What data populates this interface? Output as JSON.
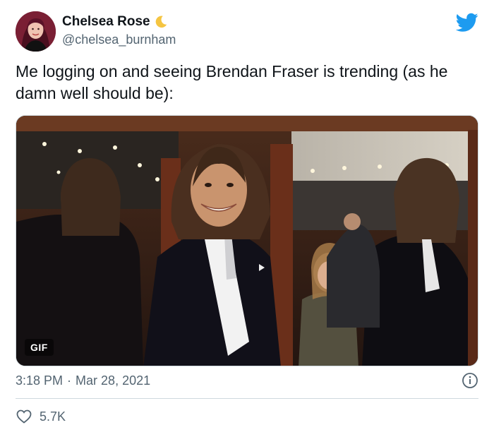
{
  "author": {
    "display_name": "Chelsea Rose",
    "name_emoji": "crescent-moon-icon",
    "handle": "@chelsea_burnham"
  },
  "tweet": {
    "text": "Me logging on and seeing Brendan Fraser is trending (as he damn well should be):"
  },
  "media": {
    "badge": "GIF"
  },
  "meta": {
    "time": "3:18 PM",
    "separator": "·",
    "date": "Mar 28, 2021"
  },
  "actions": {
    "likes": "5.7K"
  },
  "colors": {
    "brand_blue": "#1d9bf0",
    "text_primary": "#0f1419",
    "text_secondary": "#536471",
    "border": "#cfd9de"
  }
}
